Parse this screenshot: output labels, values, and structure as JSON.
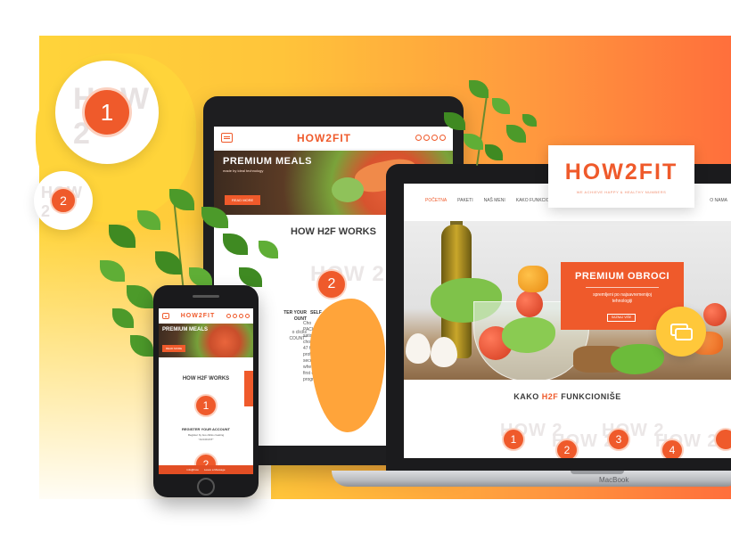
{
  "brand": {
    "logo": "HOW2FIT",
    "tagline": "WE ACHIEVE HAPPY & HEALTHY NUMBERS",
    "accent": "#ef5a2b",
    "yellow": "#ffd43a"
  },
  "floating_steps": [
    "1",
    "2"
  ],
  "ghost_text": "HOW 2",
  "tablet": {
    "banner_title": "PREMIUM MEALS",
    "banner_sub": "made by ideal technology",
    "banner_button": "READ MORE",
    "section_title": "HOW H2F WORKS",
    "step": "2",
    "step_label_left": "TER YOUR\nOUNT",
    "step_label_right": "SELF",
    "step_text_left": "o clicks\nCOUNT\"",
    "step_text_right": "Cho\nPACK\nsatis\nchoi\n47 fo\nprofe\nsecond ste\nwhen your\nfirst order of the\nprogram"
  },
  "laptop": {
    "nav": [
      "POČETNA",
      "PAKETI",
      "NAŠ MENI",
      "KAKO FUNKCIONIŠE"
    ],
    "nav_right": "O NAMA",
    "hero_title": "PREMIUM OBROCI",
    "hero_sub": "spremljeni po najsavremenijoj\ntehnologiji",
    "hero_button": "SAZNAJ VIŠE",
    "section_title_pre": "KAKO ",
    "section_title_hl": "H2F",
    "section_title_post": " FUNKCIONIŠE",
    "steps": [
      "1",
      "2",
      "3",
      "4"
    ],
    "brand_label": "MacBook"
  },
  "phone": {
    "banner_title": "PREMIUM MEALS",
    "banner_button": "READ MORE",
    "section_title": "HOW H2F WORKS",
    "step1": "1",
    "step1_title": "REGISTER YOUR ACCOUNT",
    "step1_text": "Register by two clicks creating\n\"ACCOUNT\"",
    "step2": "2",
    "footer_left": "info@how",
    "footer_right": "Leave a Message"
  }
}
